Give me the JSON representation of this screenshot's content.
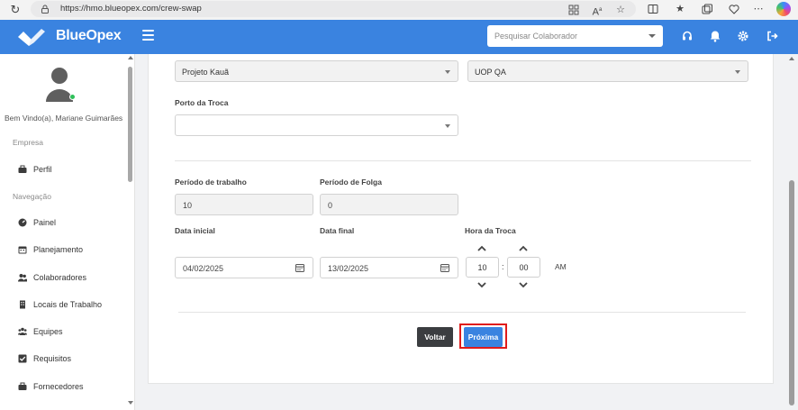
{
  "browser": {
    "url": "https://hmo.blueopex.com/crew-swap"
  },
  "app": {
    "brand": "BlueOpex",
    "search_placeholder": "Pesquisar Colaborador",
    "colors": {
      "primary": "#3a83e0",
      "dark_button": "#3b3d40",
      "highlight": "#e01b1b",
      "online": "#2fbf5a"
    }
  },
  "sidebar": {
    "welcome": "Bem Vindo(a), Mariane Guimarães",
    "section_empresa": "Empresa",
    "section_navegacao": "Navegação",
    "items": [
      {
        "label": "Perfil",
        "icon": "briefcase-icon"
      },
      {
        "label": "Painel",
        "icon": "dashboard-icon"
      },
      {
        "label": "Planejamento",
        "icon": "calendar-icon"
      },
      {
        "label": "Colaboradores",
        "icon": "users-icon"
      },
      {
        "label": "Locais de Trabalho",
        "icon": "building-icon"
      },
      {
        "label": "Equipes",
        "icon": "team-icon"
      },
      {
        "label": "Requisitos",
        "icon": "checkbox-icon"
      },
      {
        "label": "Fornecedores",
        "icon": "briefcase-icon"
      }
    ]
  },
  "form": {
    "project_select": "Projeto Kauã",
    "uop_select": "UOP QA",
    "porto_label": "Porto da Troca",
    "porto_value": "",
    "periodo_trabalho_label": "Período de trabalho",
    "periodo_trabalho_value": "10",
    "periodo_folga_label": "Período de Folga",
    "periodo_folga_value": "0",
    "data_inicial_label": "Data inicial",
    "data_inicial_value": "04/02/2025",
    "data_final_label": "Data final",
    "data_final_value": "13/02/2025",
    "hora_label": "Hora da Troca",
    "hour": "10",
    "minute": "00",
    "colon": ":",
    "meridiem": "AM",
    "voltar_label": "Voltar",
    "proxima_label": "Próxima"
  }
}
